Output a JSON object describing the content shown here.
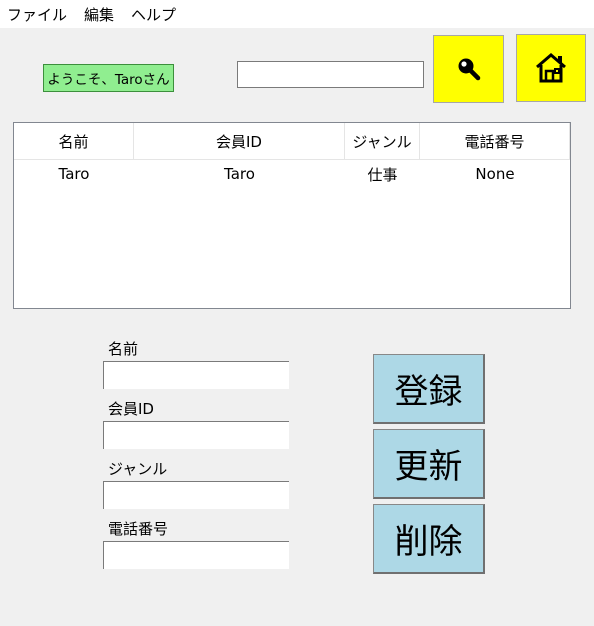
{
  "menu": [
    "ファイル",
    "編集",
    "ヘルプ"
  ],
  "welcome_text": "ようこそ、Taroさん",
  "search": {
    "value": "",
    "placeholder": ""
  },
  "icons": {
    "search": "magnifier-icon",
    "home": "home-icon",
    "accent": "#ffff00"
  },
  "table": {
    "columns": [
      "名前",
      "会員ID",
      "ジャンル",
      "電話番号"
    ],
    "rows": [
      [
        "Taro",
        "Taro",
        "仕事",
        "None"
      ]
    ]
  },
  "form": {
    "fields": [
      {
        "label": "名前",
        "value": ""
      },
      {
        "label": "会員ID",
        "value": ""
      },
      {
        "label": "ジャンル",
        "value": ""
      },
      {
        "label": "電話番号",
        "value": ""
      }
    ]
  },
  "actions": {
    "register": "登録",
    "update": "更新",
    "delete": "削除"
  },
  "colors": {
    "welcome_bg": "#90ee90",
    "action_bg": "#add8e6",
    "icon_btn_bg": "#ffff00"
  }
}
